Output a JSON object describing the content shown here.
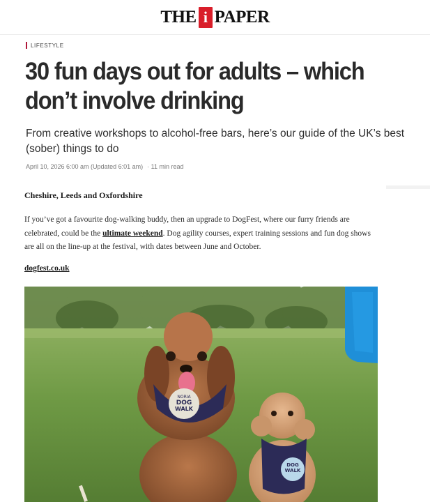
{
  "masthead": {
    "brand_left": "THE",
    "brand_mark": "i",
    "brand_right": "PAPER"
  },
  "article": {
    "section": "LIFESTYLE",
    "headline": "30 fun days out for adults – which don’t involve drinking",
    "standfirst": "From creative workshops to alcohol-free bars, here’s our guide of the UK’s best (sober) things to do",
    "date": "April 10, 2026 6:00 am (Updated 6:01 am)",
    "read_time": "· 11 min read",
    "subhead": "Cheshire, Leeds and Oxfordshire",
    "para_before_link": "If you’ve got a favourite dog-walking buddy, then an upgrade to DogFest, where our furry friends are celebrated, could be the ",
    "para_link": "ultimate weekend",
    "para_after_link": ". Dog agility courses, expert training sessions and fun dog shows are all on the line-up at the festival, with dates between June and October.",
    "website": "dogfest.co.uk",
    "image": {
      "bandana_big_line1": "NORIA",
      "bandana_big_line2": "DOG",
      "bandana_big_line3": "WALK",
      "bandana_small_line1": "DOG",
      "bandana_small_line2": "WALK"
    }
  },
  "colors": {
    "brand_red": "#d91e2a",
    "section_bar": "#b0183a",
    "grass": "#6f9a45",
    "banner_blue": "#1f8fd8"
  }
}
